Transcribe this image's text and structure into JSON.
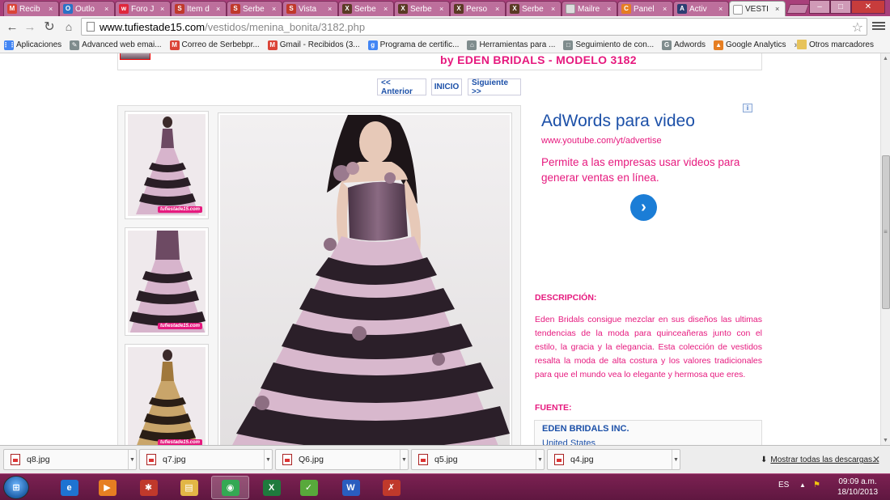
{
  "browser": {
    "tabs": [
      {
        "title": "Recib",
        "fav": "M",
        "color": "#db4437"
      },
      {
        "title": "Outlo",
        "fav": "O",
        "color": "#2a72c6"
      },
      {
        "title": "Foro J",
        "fav": "w",
        "color": "#e0273c"
      },
      {
        "title": "Ítem d",
        "fav": "S",
        "color": "#c0392b"
      },
      {
        "title": "Serbe",
        "fav": "S",
        "color": "#c0392b"
      },
      {
        "title": "Vista",
        "fav": "S",
        "color": "#c0392b"
      },
      {
        "title": "Serbe",
        "fav": "X",
        "color": "#5a3a24"
      },
      {
        "title": "Serbe",
        "fav": "X",
        "color": "#5a3a24"
      },
      {
        "title": "Perso",
        "fav": "X",
        "color": "#5a3a24"
      },
      {
        "title": "Serbe",
        "fav": "X",
        "color": "#5a3a24"
      },
      {
        "title": "Mailre",
        "fav": "",
        "color": "#dcdcdc"
      },
      {
        "title": "Panel",
        "fav": "C",
        "color": "#e67e22"
      },
      {
        "title": "Activ",
        "fav": "A",
        "color": "#2c3e72"
      },
      {
        "title": "VESTI",
        "fav": "",
        "color": "#ffffff"
      }
    ],
    "url_host": "www.tufiestade15.com",
    "url_path": "/vestidos/menina_bonita/3182.php",
    "bookmarks": [
      {
        "label": "Aplicaciones",
        "icon": "⋮⋮",
        "color": "#4285f4"
      },
      {
        "label": "Advanced web emai...",
        "icon": "✎",
        "color": "#7f8c8d"
      },
      {
        "label": "Correo de Serbebpr...",
        "icon": "M",
        "color": "#db4437"
      },
      {
        "label": "Gmail - Recibidos (3...",
        "icon": "M",
        "color": "#db4437"
      },
      {
        "label": "Programa de certific...",
        "icon": "g",
        "color": "#4285f4"
      },
      {
        "label": "Herramientas para ...",
        "icon": "⌂",
        "color": "#7f8c8d"
      },
      {
        "label": "Seguimiento de con...",
        "icon": "□",
        "color": "#7f8c8d"
      },
      {
        "label": "Adwords",
        "icon": "G",
        "color": "#7f8c8d"
      },
      {
        "label": "Google Analytics",
        "icon": "▲",
        "color": "#e67e22"
      }
    ],
    "bookmarks_more": "»",
    "other_bookmarks": "Otros marcadores",
    "win_min": "–",
    "win_max": "□",
    "win_close": "✕"
  },
  "page": {
    "header_title": "by EDEN BRIDALS - MODELO 3182",
    "pager": {
      "prev": "<< Anterior",
      "home": "INICIO",
      "next": "Siguiente >>"
    },
    "watermark": "tufiestade15.com",
    "ad": {
      "title": "AdWords para video",
      "url": "www.youtube.com/yt/advertise",
      "text": "Permite a las empresas usar videos para generar ventas en línea.",
      "go": "›",
      "info": "i"
    },
    "description_heading": "DESCRIPCIÓN:",
    "description": "Eden Bridals consigue mezclar en sus diseños las ultimas tendencias de la moda para quinceañeras junto con el estilo, la gracia y la elegancia. Esta colección de vestidos resalta la moda de alta costura y los valores tradicionales para que el mundo vea lo elegante y hermosa que eres.",
    "source_heading": "FUENTE:",
    "source_name": "EDEN BRIDALS INC.",
    "source_country": "United States"
  },
  "downloads": {
    "items": [
      "q8.jpg",
      "q7.jpg",
      "Q6.jpg",
      "q5.jpg",
      "q4.jpg"
    ],
    "show_all": "Mostrar todas las descargas...",
    "close": "✕"
  },
  "taskbar": {
    "apps": [
      {
        "name": "internet-explorer",
        "glyph": "e",
        "color": "#1e73d2"
      },
      {
        "name": "media-player",
        "glyph": "▶",
        "color": "#e67e22"
      },
      {
        "name": "red-shield-app",
        "glyph": "✱",
        "color": "#c0392b"
      },
      {
        "name": "file-explorer",
        "glyph": "▤",
        "color": "#e2b646"
      },
      {
        "name": "chrome",
        "glyph": "◉",
        "color": "#34a853"
      },
      {
        "name": "excel",
        "glyph": "X",
        "color": "#1f7a3d"
      },
      {
        "name": "green-app",
        "glyph": "✓",
        "color": "#58a93b"
      },
      {
        "name": "word",
        "glyph": "W",
        "color": "#2a5dbf"
      },
      {
        "name": "red-app",
        "glyph": "✗",
        "color": "#c0392b"
      }
    ],
    "lang": "ES",
    "time": "09:09 a.m.",
    "date": "18/10/2013"
  }
}
